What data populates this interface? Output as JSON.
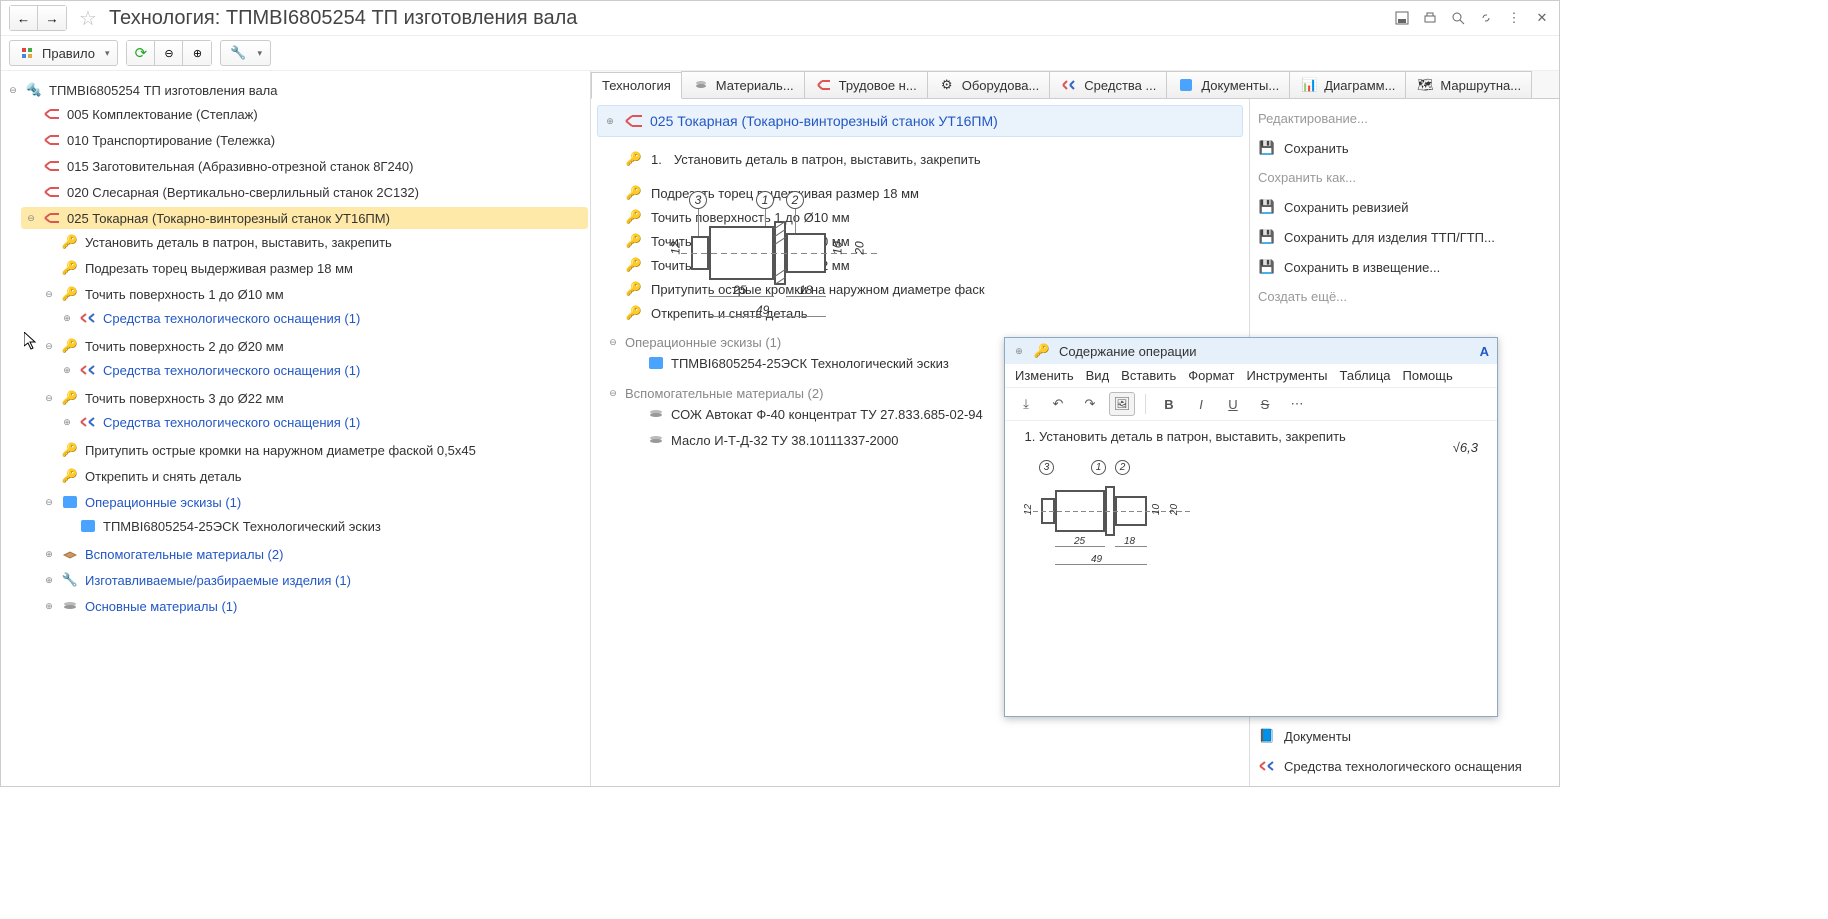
{
  "header": {
    "title": "Технология: ТПМВI6805254 ТП изготовления вала"
  },
  "toolbar": {
    "rule_label": "Правило"
  },
  "tree": {
    "root": "ТПМВI6805254 ТП изготовления вала",
    "op005": "005 Комплектование (Степлаж)",
    "op010": "010 Транспортирование (Тележка)",
    "op015": "015 Заготовительная (Абразивно-отрезной станок 8Г240)",
    "op020": "020 Слесарная (Вертикально-сверлильный станок 2С132)",
    "op025": "025 Токарная (Токарно-винторезный станок УТ16ПМ)",
    "step1": "Установить деталь в патрон, выставить, закрепить",
    "step2": "Подрезать торец выдерживая размер 18 мм",
    "step3": "Точить поверхность 1 до Ø10 мм",
    "osna": "Средства технологического оснащения (1)",
    "step4": "Точить поверхность 2 до Ø20 мм",
    "step5": "Точить поверхность 3 до Ø22 мм",
    "step6": "Притупить острые кромки на наружном диаметре фаской 0,5x45",
    "step7": "Открепить и снять деталь",
    "sketches": "Операционные эскизы (1)",
    "sketch1": "ТПМВI6805254-25ЭСК Технологический эскиз",
    "aux_mat": "Вспомогательные материалы (2)",
    "made_items": "Изготавливаемые/разбираемые изделия (1)",
    "base_mat": "Основные материалы (1)"
  },
  "tabs": {
    "t0": "Технология",
    "t1": "Материаль...",
    "t2": "Трудовое н...",
    "t3": "Оборудова...",
    "t4": "Средства ...",
    "t5": "Документы...",
    "t6": "Диаграмм...",
    "t7": "Маршрутна..."
  },
  "detail": {
    "title": "025 Токарная (Токарно-винторезный станок УТ16ПМ)",
    "num1": "1.",
    "step1": "Установить деталь в патрон, выставить, закрепить",
    "step2": "Подрезать торец выдерживая размер 18 мм",
    "step3": "Точить поверхность 1 до Ø10 мм",
    "step4": "Точить поверхность 2 до Ø20 мм",
    "step5": "Точить поверхность 3 до Ø22 мм",
    "step6": "Притупить острые кромки на наружном диаметре фаск",
    "step7": "Открепить и снять деталь",
    "sketches_grp": "Операционные эскизы (1)",
    "sketch1": "ТПМВI6805254-25ЭСК Технологический эскиз",
    "aux_grp": "Вспомогательные материалы (2)",
    "aux1": "СОЖ Автокат Ф-40 концентрат ТУ 27.833.685-02-94",
    "aux2": "Масло И-Т-Д-32 ТУ 38.10111337-2000"
  },
  "actions": {
    "edit_grp": "Редактирование...",
    "save": "Сохранить",
    "save_as_grp": "Сохранить как...",
    "save_rev": "Сохранить ревизией",
    "save_ttp": "Сохранить для изделия ТТП/ГТП...",
    "save_notice": "Сохранить в извещение...",
    "create_grp": "Создать ещё...",
    "docs": "Документы",
    "tooling": "Средства технологического оснащения"
  },
  "editor": {
    "title": "Содержание операции",
    "m_change": "Изменить",
    "m_view": "Вид",
    "m_insert": "Вставить",
    "m_format": "Формат",
    "m_tools": "Инструменты",
    "m_table": "Таблица",
    "m_help": "Помощь",
    "content": "Установить деталь в патрон, выставить, закрепить",
    "num1": "1."
  },
  "diagram": {
    "rough": "6,3",
    "c1": "1",
    "c2": "2",
    "c3": "3",
    "d25": "25",
    "d18": "18",
    "d49": "49",
    "d12": "12",
    "d10": "10",
    "d20": "20"
  }
}
